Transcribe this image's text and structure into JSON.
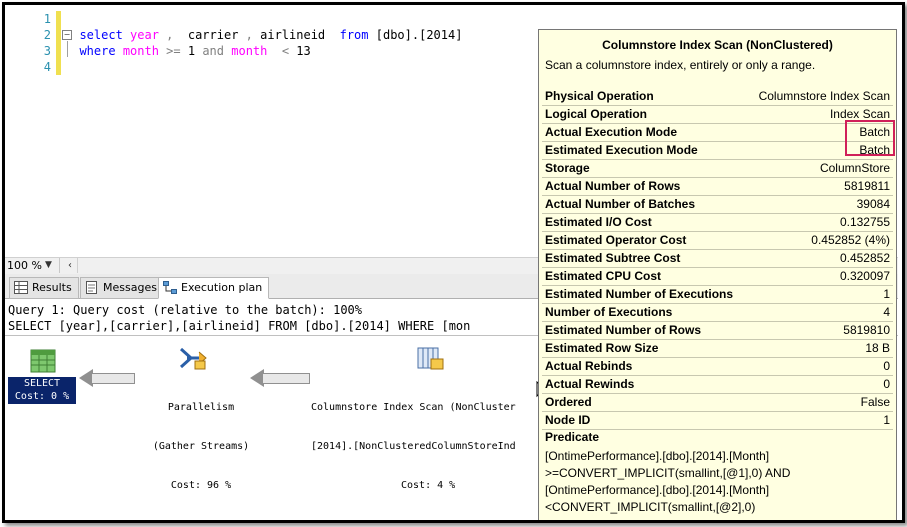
{
  "editor": {
    "line_numbers": [
      "1",
      "2",
      "3",
      "4"
    ],
    "line2": {
      "kw1": "select",
      "c1": "year",
      "sep1": " ,",
      "c2": "carrier",
      "sep2": " ,",
      "c3": "airlineid",
      "kw2": "from",
      "tbl": "[dbo].[2014]"
    },
    "line3": {
      "kw1": "where",
      "c1": "month",
      "op1": ">=",
      "v1": "1",
      "kw2": "and",
      "c2": "month",
      "op2": "<",
      "v2": "13"
    },
    "zoom": "100 %"
  },
  "tabs": [
    {
      "label": "Results"
    },
    {
      "label": "Messages"
    },
    {
      "label": "Execution plan"
    }
  ],
  "plan": {
    "query_cost": "Query 1: Query cost (relative to the batch): 100%",
    "query_text": "SELECT [year],[carrier],[airlineid] FROM [dbo].[2014] WHERE [mon",
    "nodes": {
      "select_label": "SELECT",
      "select_cost": "Cost: 0 %",
      "parallelism_label": "Parallelism",
      "parallelism_sub": "(Gather Streams)",
      "parallelism_cost": "Cost: 96 %",
      "scan_label": "Columnstore Index Scan (NonCluster",
      "scan_sub": "[2014].[NonClusteredColumnStoreInd",
      "scan_cost": "Cost: 4 %"
    }
  },
  "tooltip": {
    "title": "Columnstore Index Scan (NonClustered)",
    "description": "Scan a columnstore index, entirely or only a range.",
    "rows": [
      {
        "label": "Physical Operation",
        "value": "Columnstore Index Scan"
      },
      {
        "label": "Logical Operation",
        "value": "Index Scan"
      },
      {
        "label": "Actual Execution Mode",
        "value": "Batch"
      },
      {
        "label": "Estimated Execution Mode",
        "value": "Batch"
      },
      {
        "label": "Storage",
        "value": "ColumnStore"
      },
      {
        "label": "Actual Number of Rows",
        "value": "5819811"
      },
      {
        "label": "Actual Number of Batches",
        "value": "39084"
      },
      {
        "label": "Estimated I/O Cost",
        "value": "0.132755"
      },
      {
        "label": "Estimated Operator Cost",
        "value": "0.452852 (4%)"
      },
      {
        "label": "Estimated Subtree Cost",
        "value": "0.452852"
      },
      {
        "label": "Estimated CPU Cost",
        "value": "0.320097"
      },
      {
        "label": "Estimated Number of Executions",
        "value": "1"
      },
      {
        "label": "Number of Executions",
        "value": "4"
      },
      {
        "label": "Estimated Number of Rows",
        "value": "5819810"
      },
      {
        "label": "Estimated Row Size",
        "value": "18 B"
      },
      {
        "label": "Actual Rebinds",
        "value": "0"
      },
      {
        "label": "Actual Rewinds",
        "value": "0"
      },
      {
        "label": "Ordered",
        "value": "False"
      },
      {
        "label": "Node ID",
        "value": "1"
      }
    ],
    "predicate_title": "Predicate",
    "predicate_lines": [
      "[OntimePerformance].[dbo].[2014].[Month]",
      ">=CONVERT_IMPLICIT(smallint,[@1],0) AND",
      "[OntimePerformance].[dbo].[2014].[Month]",
      "<CONVERT_IMPLICIT(smallint,[@2],0)"
    ]
  },
  "colors": {
    "keyword": "#0000ff",
    "identifier_pink": "#ff00ff",
    "highlight_box": "#d0205a",
    "tooltip_bg": "#ffffe1",
    "select_bg": "#0a246a"
  }
}
